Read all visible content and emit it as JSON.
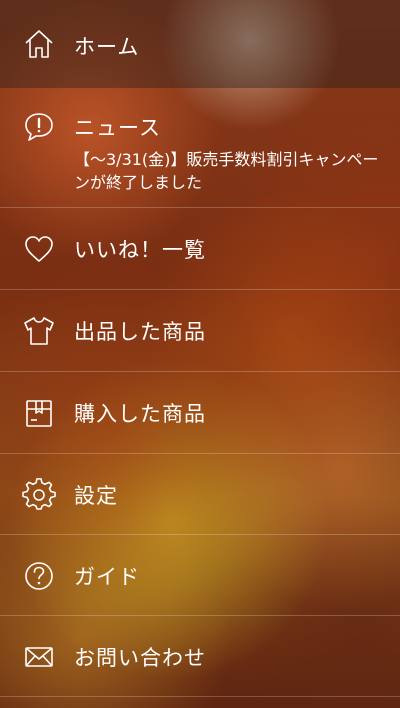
{
  "menu": {
    "home": {
      "label": "ホーム",
      "icon": "home-icon"
    },
    "news": {
      "label": "ニュース",
      "icon": "exclamation-speech-bubble-icon",
      "body": "【〜3/31(金)】販売手数料割引キャンペーンが終了しました"
    },
    "likes": {
      "label": "いいね！一覧",
      "icon": "heart-icon"
    },
    "listed": {
      "label": "出品した商品",
      "icon": "t-shirt-icon"
    },
    "purchased": {
      "label": "購入した商品",
      "icon": "box-icon"
    },
    "settings": {
      "label": "設定",
      "icon": "gear-icon"
    },
    "guide": {
      "label": "ガイド",
      "icon": "question-circle-icon"
    },
    "contact": {
      "label": "お問い合わせ",
      "icon": "envelope-icon"
    }
  },
  "colors": {
    "text": "#ffffff",
    "divider": "rgba(255,255,255,0.22)",
    "active_row": "rgba(30,30,30,0.38)"
  }
}
